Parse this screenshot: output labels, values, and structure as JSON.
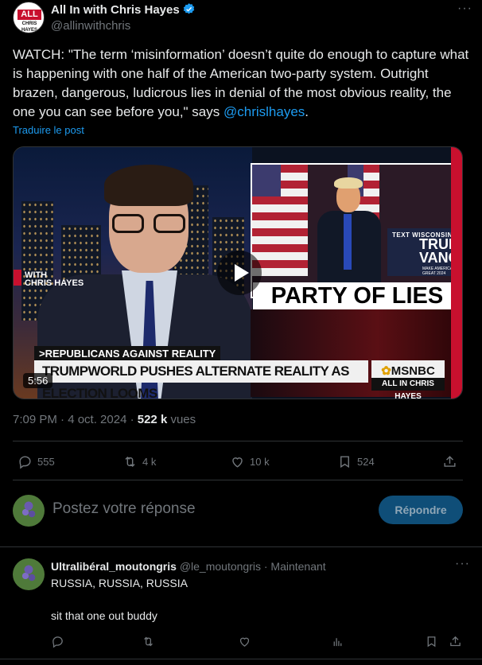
{
  "author": {
    "name": "All In with Chris Hayes",
    "handle": "@allinwithchris",
    "avatar_text": "ALL IN",
    "avatar_subtext": "CHRIS HAYES",
    "verified": true
  },
  "tweet": {
    "text_before_mention": "WATCH: \"The term ‘misinformation’ doesn’t quite do enough to capture what is happening with one half of the American two-party system. Outright brazen, dangerous, ludicrous lies in denial of the most obvious reality, the one you can see before you,\" says ",
    "mention": "@chrislhayes",
    "text_after_mention": ".",
    "translate_label": "Traduire le post"
  },
  "video": {
    "duration": "5:56",
    "inset_sign_top": "TEXT WISCONSIN",
    "inset_sign_main": "TRUM\nVANC",
    "inset_sign_small": "MAKE AMERICA GREAT 2024",
    "banner": "PARTY OF LIES",
    "show_tag": "WITH\nCHRIS HAYES",
    "show_tag_big": "ALL",
    "lower_third_label": ">REPUBLICANS AGAINST REALITY",
    "lower_third_main": "TRUMPWORLD PUSHES ALTERNATE REALITY AS ELECTION LOOMS",
    "network": "MSNBC",
    "program_strip": "ALL IN CHRIS HAYES"
  },
  "meta": {
    "time_date": "7:09 PM · 4 oct. 2024 · ",
    "views_count": "522 k",
    "views_label": " vues"
  },
  "actions": {
    "replies": "555",
    "reposts": "4 k",
    "likes": "10 k",
    "bookmarks": "524"
  },
  "reply_box": {
    "placeholder": "Postez votre réponse",
    "button_label": "Répondre"
  },
  "comment": {
    "name": "Ultralibéral_moutongris",
    "handle": "@le_moutongris · Maintenant",
    "line1": "RUSSIA, RUSSIA, RUSSIA",
    "line2": "sit that one out buddy"
  },
  "colors": {
    "accent": "#1d9bf0",
    "background": "#000000",
    "muted": "#71767b",
    "network_red": "#c8102e"
  }
}
